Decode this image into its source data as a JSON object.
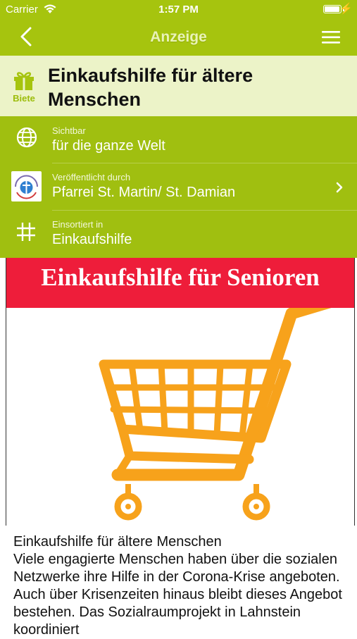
{
  "status_bar": {
    "carrier": "Carrier",
    "time": "1:57 PM",
    "battery_level": 1.0
  },
  "nav": {
    "title": "Anzeige",
    "back_icon": "chevron-left-icon",
    "menu_icon": "hamburger-icon"
  },
  "listing": {
    "type_label": "Biete",
    "type_icon": "gift-icon",
    "title": "Einkaufshilfe für ältere Menschen"
  },
  "info_rows": {
    "visibility": {
      "label": "Sichtbar",
      "value": "für die ganze Welt",
      "icon": "globe-icon"
    },
    "publisher": {
      "label": "Veröffentlicht durch",
      "value": "Pfarrei St. Martin/ St. Damian",
      "icon": "parish-logo"
    },
    "category": {
      "label": "Einsortiert in",
      "value": "Einkaufshilfe",
      "icon": "hashtag-icon"
    }
  },
  "poster": {
    "title": "Einkaufshilfe für Senioren",
    "image": "shopping-cart"
  },
  "description": {
    "heading": "Einkaufshilfe für ältere Menschen",
    "body": "Viele engagierte Menschen haben über die sozialen Netzwerke ihre Hilfe in der Corona-Krise angeboten. Auch über Krisenzeiten hinaus bleibt dieses Angebot bestehen. Das Sozialraumprojekt in Lahnstein koordiniert"
  },
  "colors": {
    "accent": "#a6c40e",
    "header_bg": "#ecf3c8",
    "banner_red": "#ee1d3a",
    "cart_orange": "#f7a21b"
  }
}
